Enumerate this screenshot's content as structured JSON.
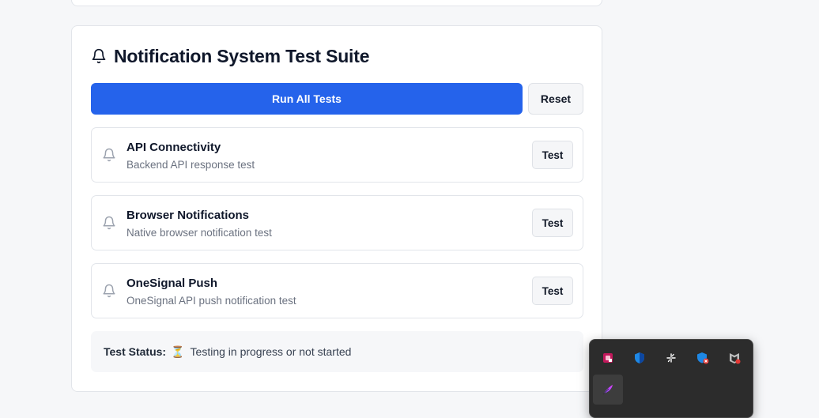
{
  "suite": {
    "title": "Notification System Test Suite",
    "run_all_label": "Run All Tests",
    "reset_label": "Reset",
    "tests": [
      {
        "name": "API Connectivity",
        "description": "Backend API response test",
        "button_label": "Test"
      },
      {
        "name": "Browser Notifications",
        "description": "Native browser notification test",
        "button_label": "Test"
      },
      {
        "name": "OneSignal Push",
        "description": "OneSignal API push notification test",
        "button_label": "Test"
      }
    ],
    "status": {
      "label": "Test Status:",
      "icon": "⏳",
      "text": "Testing in progress or not started"
    }
  },
  "tray_overflow": {
    "icons": [
      "app-pink-icon",
      "windows-security-shield-icon",
      "sparkle-cursor-icon",
      "defender-alert-icon",
      "mcafee-alert-icon",
      "feather-app-icon"
    ]
  },
  "colors": {
    "primary": "#2563eb",
    "card_border": "#e2e5ea",
    "muted_text": "#6b7280",
    "tray_bg": "#2c2c2c"
  }
}
